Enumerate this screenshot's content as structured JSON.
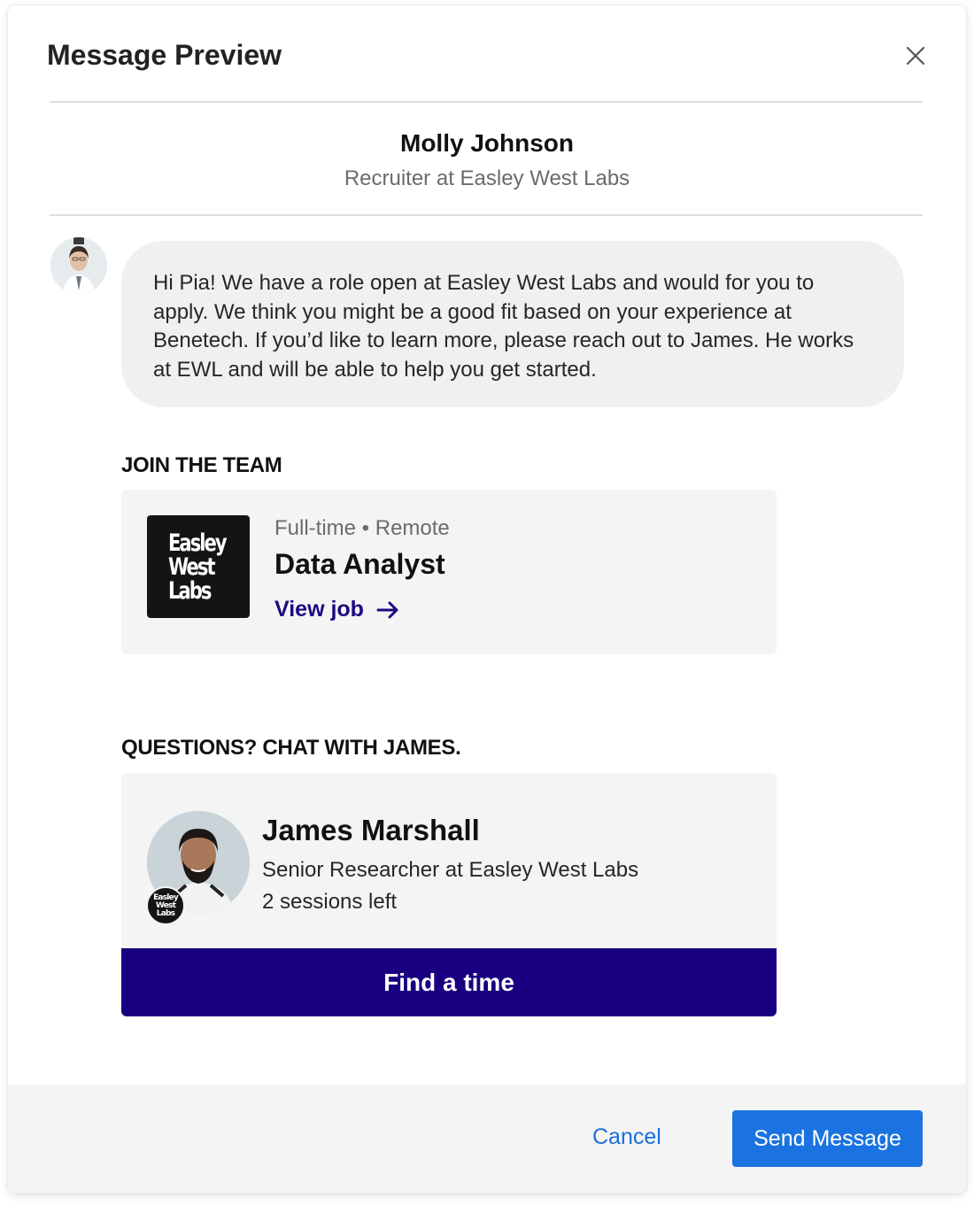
{
  "modal": {
    "title": "Message Preview"
  },
  "sender": {
    "name": "Molly Johnson",
    "role": "Recruiter at Easley West Labs"
  },
  "message": {
    "body": "Hi Pia! We have a role open at Easley West Labs and would for you to apply. We think you might be a good fit based on your experience at Benetech. If you’d like to learn more, please reach out to James. He works at EWL and will be able to help you get started."
  },
  "job_section": {
    "heading": "JOIN THE TEAM",
    "logo_lines": [
      "Easley",
      "West",
      "Labs"
    ],
    "meta": "Full-time • Remote",
    "title": "Data Analyst",
    "link_label": "View job"
  },
  "contact_section": {
    "heading": "QUESTIONS? CHAT WITH JAMES.",
    "name": "James Marshall",
    "role": "Senior Researcher at Easley West Labs",
    "sessions": "2 sessions left",
    "cta_label": "Find a time"
  },
  "footer": {
    "cancel_label": "Cancel",
    "send_label": "Send Message"
  },
  "colors": {
    "primary_navy": "#1a0080",
    "link_navy": "#1b0a80",
    "send_blue": "#1a73e0",
    "cancel_blue": "#1a6fd8",
    "bubble_gray": "#f0f0f0",
    "card_gray": "#f4f4f5"
  },
  "icons": {
    "close": "close-icon",
    "view_job_arrow": "arrow-right-icon"
  }
}
